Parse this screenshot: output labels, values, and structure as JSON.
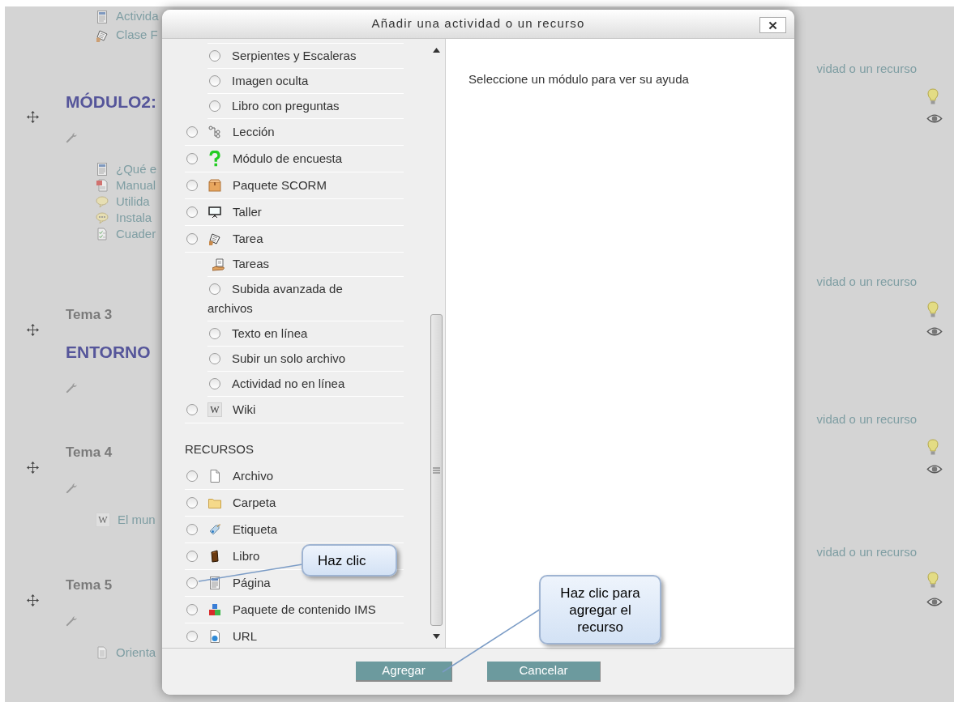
{
  "course": {
    "sections": [
      {
        "items": [
          {
            "label": "Activida"
          },
          {
            "label": "Clase F"
          }
        ],
        "add_link": "vidad o un recurso"
      },
      {
        "title": "MÓDULO2:",
        "items": [
          {
            "label": "¿Qué e"
          },
          {
            "label": "Manual"
          },
          {
            "label": "Utilida"
          },
          {
            "label": "Instala"
          },
          {
            "label": "Cuader"
          }
        ],
        "add_link": "vidad o un recurso"
      },
      {
        "heading": "Tema 3",
        "title": "ENTORNO",
        "add_link": "vidad o un recurso"
      },
      {
        "heading": "Tema 4",
        "items": [
          {
            "label": "El mun",
            "icon_glyph": "W"
          }
        ],
        "add_link": "vidad o un recurso"
      },
      {
        "heading": "Tema 5",
        "items": [
          {
            "label": "Orienta"
          }
        ]
      }
    ]
  },
  "dialog": {
    "title": "Añadir una actividad o un recurso",
    "help_text": "Seleccione un módulo para ver su ayuda",
    "activities": [
      {
        "kind": "group",
        "children": [
          {
            "label": "Serpientes y Escaleras",
            "selected": false
          },
          {
            "label": "Imagen oculta",
            "selected": false
          },
          {
            "label": "Libro con preguntas",
            "selected": false
          }
        ]
      },
      {
        "kind": "module",
        "label": "Lección",
        "selected": false
      },
      {
        "kind": "module",
        "label": "Módulo de encuesta",
        "selected": false
      },
      {
        "kind": "module",
        "label": "Paquete SCORM",
        "selected": false
      },
      {
        "kind": "module",
        "label": "Taller",
        "selected": false
      },
      {
        "kind": "module",
        "label": "Tarea",
        "selected": false
      },
      {
        "kind": "group",
        "label": "Tareas",
        "children": [
          {
            "label": "Subida avanzada de archivos",
            "selected": false
          },
          {
            "label": "Texto en línea",
            "selected": false
          },
          {
            "label": "Subir un solo archivo",
            "selected": false
          },
          {
            "label": "Actividad no en línea",
            "selected": false
          }
        ]
      },
      {
        "kind": "module",
        "label": "Wiki",
        "icon_glyph": "W",
        "selected": false
      }
    ],
    "resources_heading": "RECURSOS",
    "resources": [
      {
        "kind": "module",
        "label": "Archivo",
        "selected": false
      },
      {
        "kind": "module",
        "label": "Carpeta",
        "selected": false
      },
      {
        "kind": "module",
        "label": "Etiqueta",
        "selected": false
      },
      {
        "kind": "module",
        "label": "Libro",
        "selected": false
      },
      {
        "kind": "module",
        "label": "Página",
        "selected": false
      },
      {
        "kind": "module",
        "label": "Paquete de contenido IMS",
        "selected": false
      },
      {
        "kind": "module",
        "label": "URL",
        "selected": false
      }
    ],
    "buttons": [
      {
        "label": "Agregar"
      },
      {
        "label": "Cancelar"
      }
    ]
  },
  "callouts": [
    {
      "text": "Haz clic"
    },
    {
      "text": "Haz clic para agregar el recurso"
    }
  ]
}
